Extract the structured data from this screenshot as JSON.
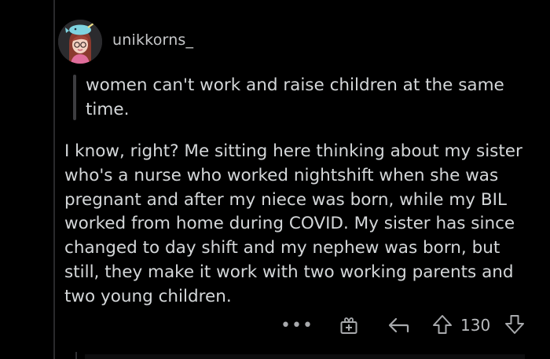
{
  "comment": {
    "username": "unikkorns_",
    "avatar_icon": "cartoon-avatar",
    "quote": "women can't work and raise children at the same time.",
    "body": "I know, right? Me sitting here thinking about my sister who's a nurse who worked nightshift when she was pregnant and after my niece was born, while my BIL worked from home during COVID.  My sister has since changed to day shift and my nephew was born, but still, they make it work with two working parents and two young children."
  },
  "actions": {
    "more_label": "•••",
    "score": "130",
    "icons": {
      "more": "more-options-icon",
      "award": "award-icon",
      "reply": "reply-icon",
      "upvote": "upvote-arrow-icon",
      "downvote": "downvote-arrow-icon"
    }
  },
  "colors": {
    "background": "#000000",
    "text": "#d4d7d9",
    "muted": "#a8aaad"
  }
}
